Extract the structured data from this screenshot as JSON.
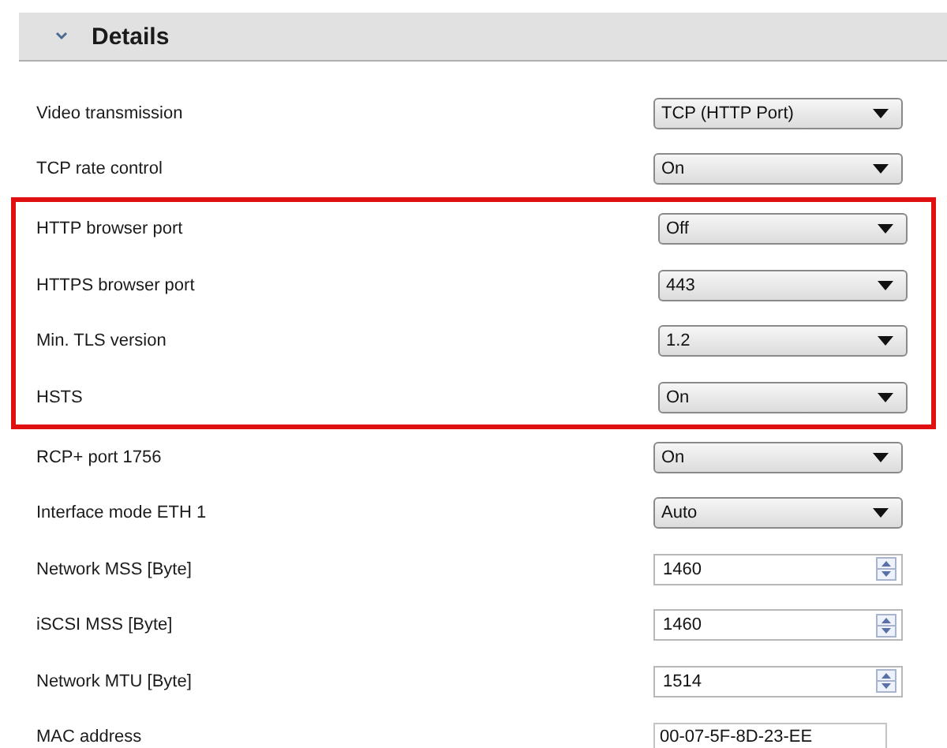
{
  "section": {
    "title": "Details",
    "expanded": true
  },
  "groups": [
    {
      "highlighted": false,
      "fields": [
        {
          "label": "Video transmission",
          "kind": "dropdown",
          "value": "TCP (HTTP Port)"
        },
        {
          "label": "TCP rate control",
          "kind": "dropdown",
          "value": "On"
        }
      ]
    },
    {
      "highlighted": true,
      "fields": [
        {
          "label": "HTTP browser port",
          "kind": "dropdown",
          "value": "Off"
        },
        {
          "label": "HTTPS browser port",
          "kind": "dropdown",
          "value": "443"
        },
        {
          "label": "Min. TLS version",
          "kind": "dropdown",
          "value": "1.2"
        },
        {
          "label": "HSTS",
          "kind": "dropdown",
          "value": "On"
        }
      ]
    },
    {
      "highlighted": false,
      "fields": [
        {
          "label": "RCP+ port 1756",
          "kind": "dropdown",
          "value": "On"
        },
        {
          "label": "Interface mode ETH 1",
          "kind": "dropdown",
          "value": "Auto"
        },
        {
          "label": "Network MSS [Byte]",
          "kind": "spinner",
          "value": "1460"
        },
        {
          "label": "iSCSI MSS [Byte]",
          "kind": "spinner",
          "value": "1460"
        },
        {
          "label": "Network MTU [Byte]",
          "kind": "spinner",
          "value": "1514"
        },
        {
          "label": "MAC address",
          "kind": "text",
          "value": "00-07-5F-8D-23-EE"
        }
      ]
    }
  ]
}
